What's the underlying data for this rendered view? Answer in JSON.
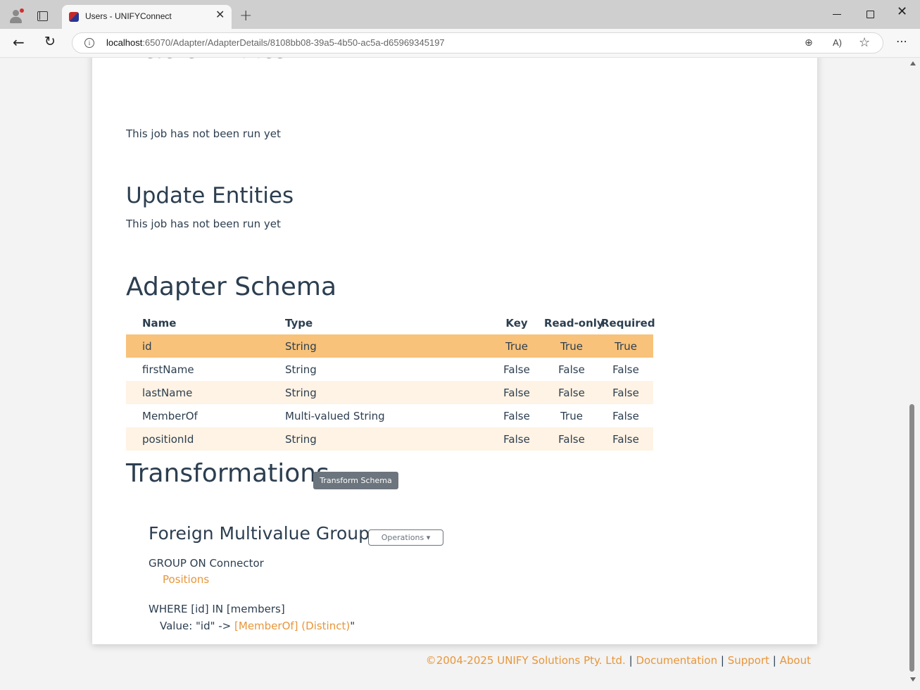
{
  "browser": {
    "tab_title": "Users - UNIFYConnect",
    "url_host": "localhost",
    "url_path": ":65070/Adapter/AdapterDetails/8108bb08-39a5-4b50-ac5a-d65969345197"
  },
  "page": {
    "cut_heading": "Delete Entities",
    "delete_status": "This job has not been run yet",
    "update_heading": "Update Entities",
    "update_status": "This job has not been run yet",
    "schema_heading": "Adapter Schema",
    "schema": {
      "headers": {
        "name": "Name",
        "type": "Type",
        "key": "Key",
        "readonly": "Read-only",
        "required": "Required"
      },
      "rows": [
        {
          "name": "id",
          "type": "String",
          "key": "True",
          "readonly": "True",
          "required": "True"
        },
        {
          "name": "firstName",
          "type": "String",
          "key": "False",
          "readonly": "False",
          "required": "False"
        },
        {
          "name": "lastName",
          "type": "String",
          "key": "False",
          "readonly": "False",
          "required": "False"
        },
        {
          "name": "MemberOf",
          "type": "Multi-valued String",
          "key": "False",
          "readonly": "True",
          "required": "False"
        },
        {
          "name": "positionId",
          "type": "String",
          "key": "False",
          "readonly": "False",
          "required": "False"
        }
      ]
    },
    "transformations_heading": "Transformations",
    "transform_schema_button": "Transform Schema",
    "transform": {
      "title": "Foreign Multivalue Group",
      "operations_button": "Operations",
      "group_on": "GROUP ON Connector",
      "connector_link": "Positions",
      "where": "WHERE [id] IN [members]",
      "value_prefix": "Value: \"id\" -> ",
      "value_link": "[MemberOf] (Distinct)",
      "value_suffix": "\""
    }
  },
  "footer": {
    "copyright": "©2004-2025 UNIFY Solutions Pty. Ltd.",
    "sep": "|",
    "documentation": "Documentation",
    "support": "Support",
    "about": "About"
  }
}
